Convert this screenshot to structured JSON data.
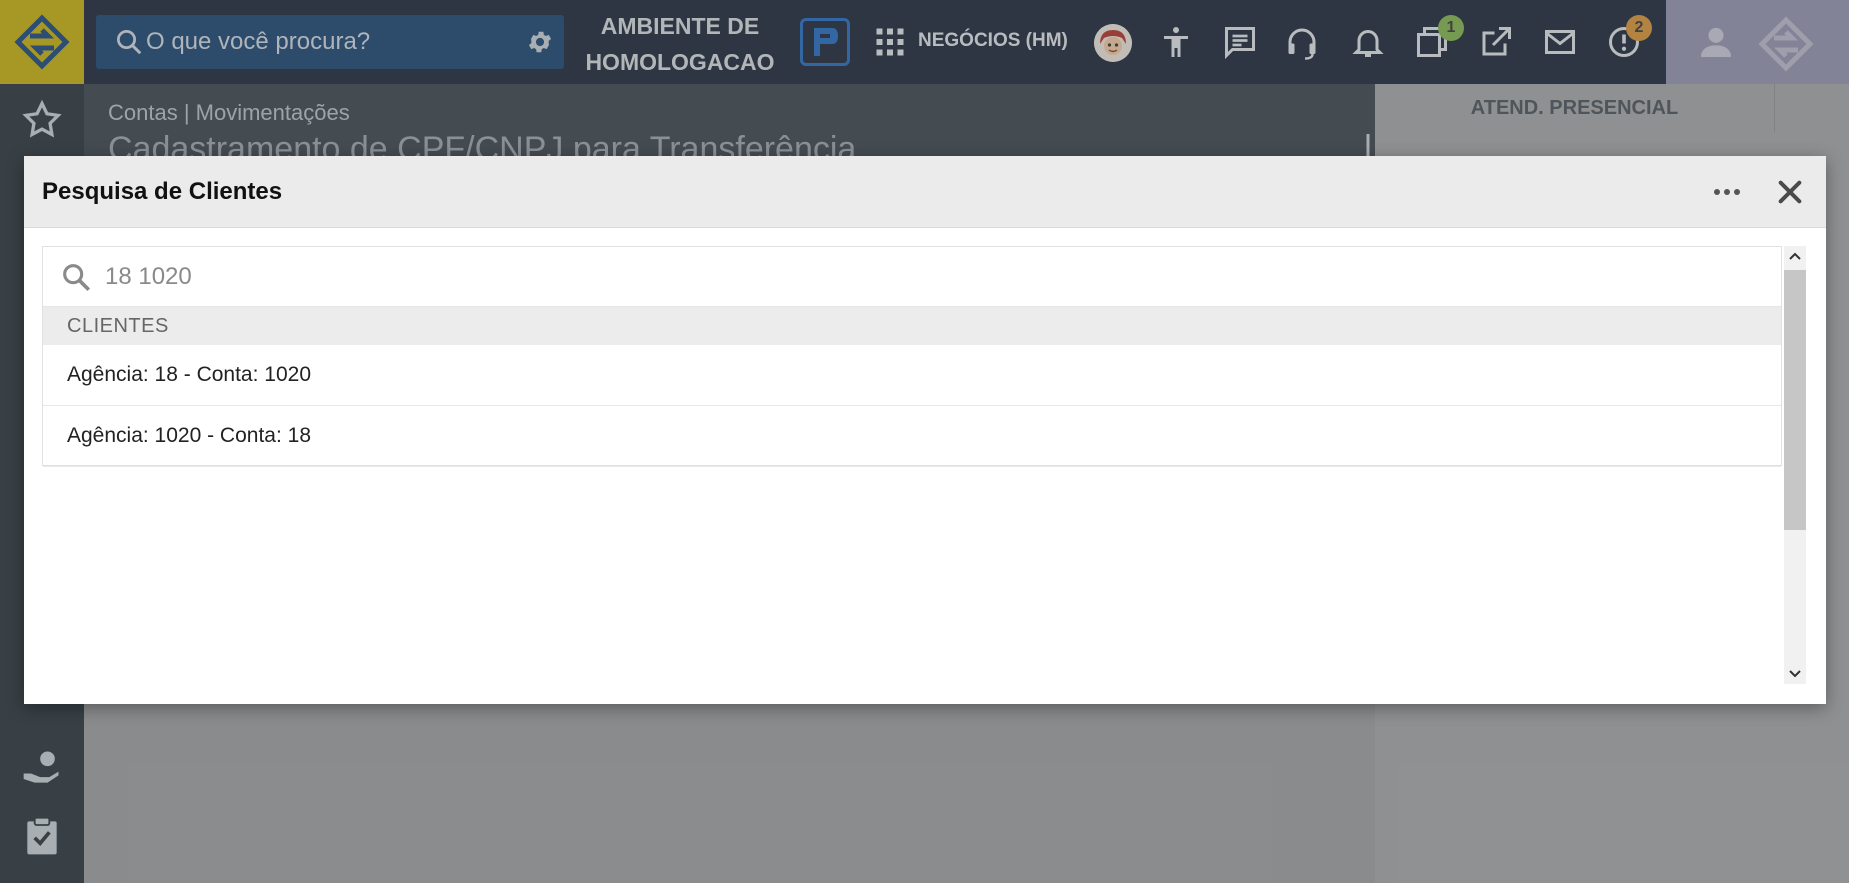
{
  "topbar": {
    "search_placeholder": "O que você procura?",
    "environment_line1": "AMBIENTE DE",
    "environment_line2": "HOMOLOGACAO",
    "negocios_label": "NEGÓCIOS (HM)",
    "windows_badge": "1",
    "alerts_badge": "2"
  },
  "page": {
    "breadcrumb": "Contas | Movimentações",
    "title": "Cadastramento de CPF/CNPJ para Transferência",
    "right_tab_label": "ATEND. PRESENCIAL"
  },
  "modal": {
    "title": "Pesquisa de Clientes",
    "search_value": "18 1020",
    "section_header": "CLIENTES",
    "results": [
      "Agência: 18 - Conta: 1020",
      "Agência: 1020 - Conta: 18"
    ]
  },
  "colors": {
    "brand_yellow": "#c7b000",
    "topbar_bg": "#0b1a2c",
    "search_bg": "#0c3b6b",
    "badge_green": "#7cb342",
    "badge_orange": "#d9902a"
  }
}
